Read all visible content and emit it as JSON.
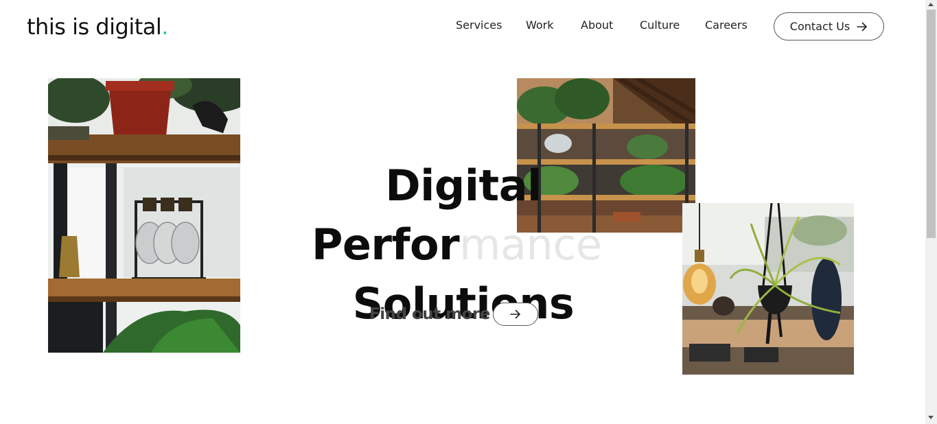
{
  "header": {
    "logo_text": "this is digital",
    "logo_dot": ".",
    "nav": [
      {
        "label": "Services",
        "name": "nav-services"
      },
      {
        "label": "Work",
        "name": "nav-work"
      },
      {
        "label": "About",
        "name": "nav-about"
      },
      {
        "label": "Culture",
        "name": "nav-culture"
      },
      {
        "label": "Careers",
        "name": "nav-careers"
      }
    ],
    "contact_label": "Contact Us",
    "contact_icon": "arrow-right-icon"
  },
  "hero": {
    "title_line1_a": "Digital Perfor",
    "title_line1_b": "mance",
    "title_line2": "Solutions",
    "cta_label": "Find out more",
    "cta_icon": "arrow-right-icon"
  },
  "images": {
    "left": "shelf-with-plants-and-bulb-jars",
    "top_right": "office-shelving-with-plants",
    "bottom_right": "hanging-plant-and-edison-bulb"
  },
  "colors": {
    "accent": "#1fcf8f",
    "text": "#111111"
  }
}
